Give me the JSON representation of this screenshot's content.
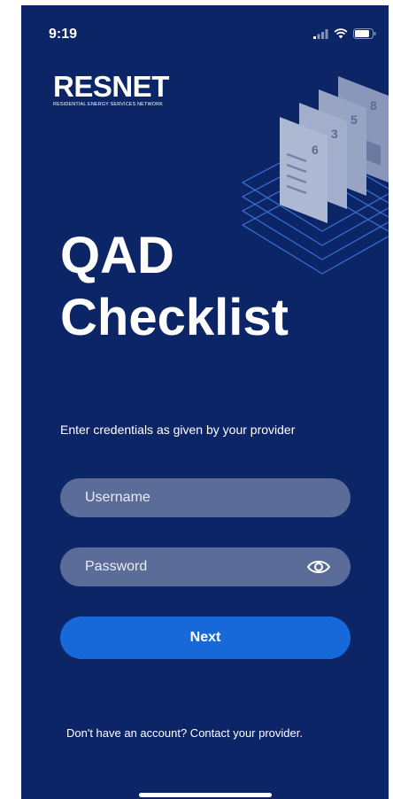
{
  "status": {
    "time": "9:19"
  },
  "logo": {
    "name": "RESNET",
    "tagline": "RESIDENTIAL ENERGY SERVICES NETWORK"
  },
  "title": {
    "line1": "QAD",
    "line2": "Checklist"
  },
  "prompt": "Enter credentials as given by your provider",
  "username": {
    "placeholder": "Username",
    "value": ""
  },
  "password": {
    "placeholder": "Password",
    "value": ""
  },
  "next_label": "Next",
  "footer": "Don't have an account? Contact your provider.",
  "illustration": {
    "pages": [
      "6",
      "3",
      "5",
      "8"
    ]
  },
  "colors": {
    "background": "#0c2567",
    "button": "#1768d8",
    "field": "#5a6e9a"
  }
}
